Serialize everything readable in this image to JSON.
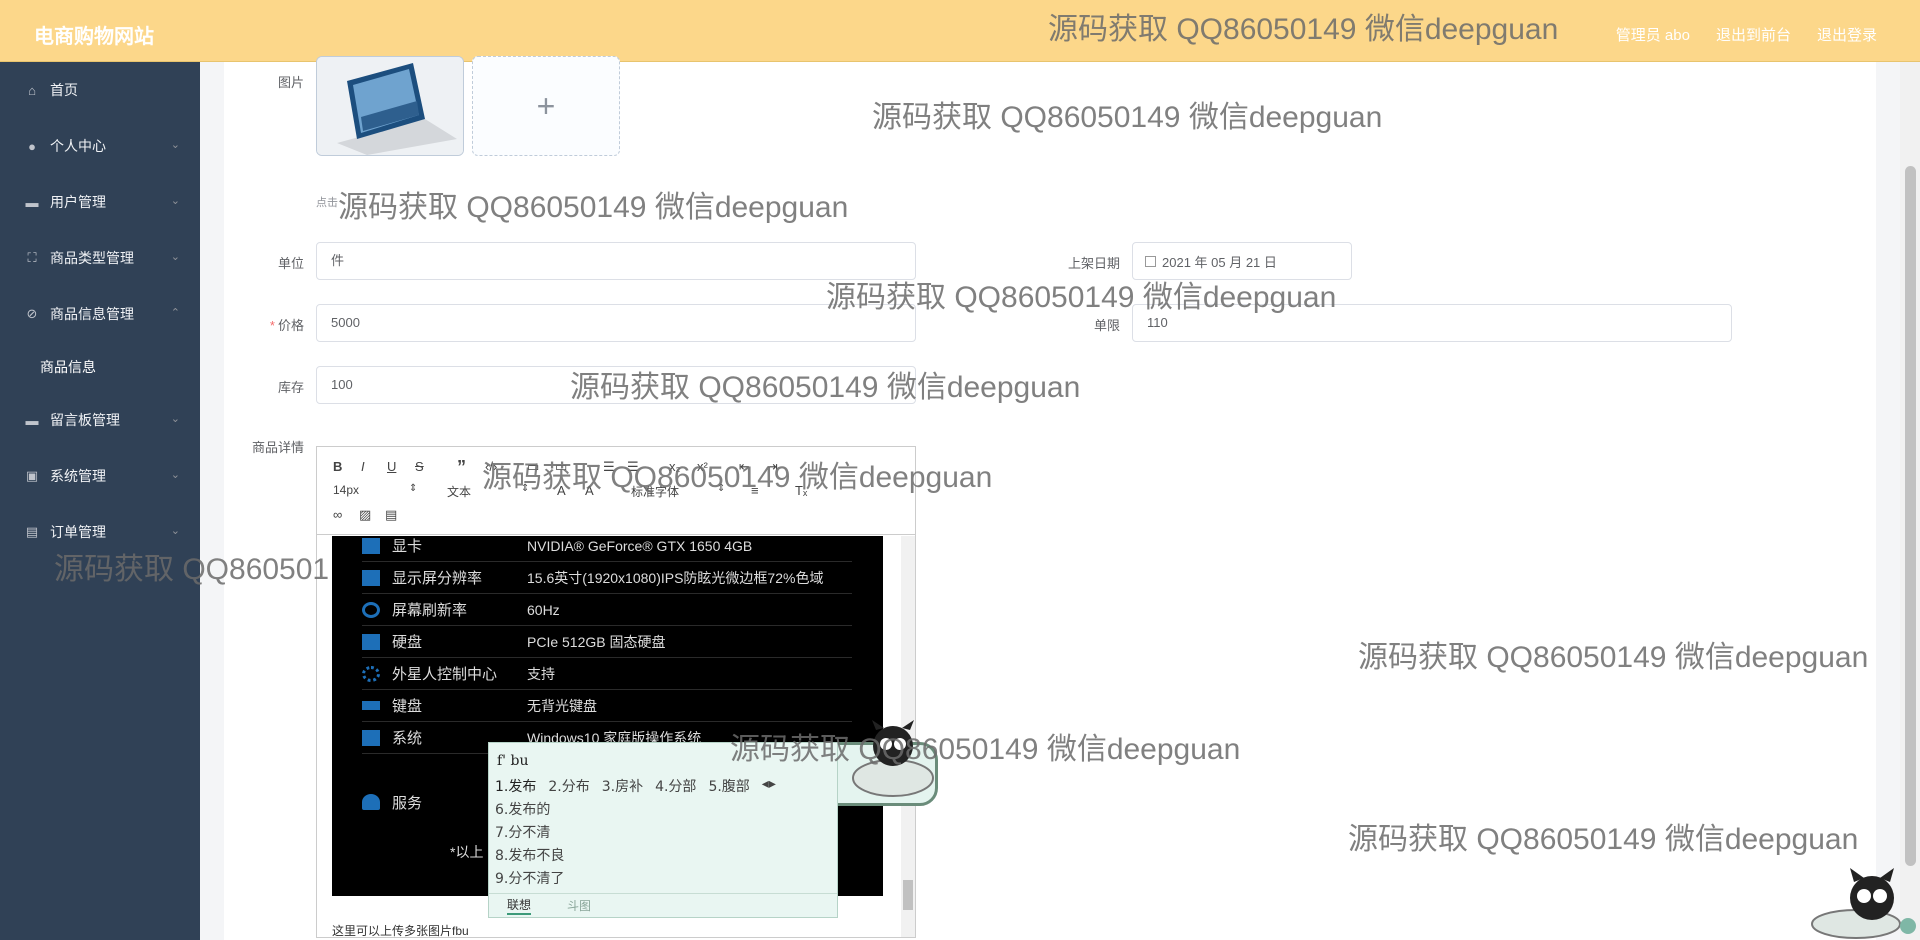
{
  "header": {
    "brand": "电商购物网站",
    "links": [
      "管理员 abo",
      "退出到前台",
      "退出登录"
    ]
  },
  "sidebar": {
    "items": [
      {
        "label": "首页",
        "icon": "home-icon",
        "arrow": ""
      },
      {
        "label": "个人中心",
        "icon": "user-icon",
        "arrow": "⌄"
      },
      {
        "label": "用户管理",
        "icon": "stamp-icon",
        "arrow": "⌄"
      },
      {
        "label": "商品类型管理",
        "icon": "fullscreen-icon",
        "arrow": "⌄"
      },
      {
        "label": "商品信息管理",
        "icon": "discount-icon",
        "arrow": "⌃"
      },
      {
        "label": "商品信息",
        "icon": "",
        "arrow": ""
      },
      {
        "label": "留言板管理",
        "icon": "chat-icon",
        "arrow": "⌄"
      },
      {
        "label": "系统管理",
        "icon": "clipboard-check-icon",
        "arrow": "⌄"
      },
      {
        "label": "订单管理",
        "icon": "document-icon",
        "arrow": "⌄"
      }
    ]
  },
  "form": {
    "image_label": "图片",
    "hint": "点击",
    "unit_label": "单位",
    "unit_value": "件",
    "price_label": "价格",
    "price_value": "5000",
    "stock_label": "库存",
    "stock_value": "100",
    "date_label": "上架日期",
    "date_value": "2021 年 05 月 21 日",
    "limit_label": "单限",
    "limit_value": "110",
    "detail_label": "商品详情"
  },
  "editor": {
    "toolbar_row1": [
      "B",
      "I",
      "U",
      "S",
      "”"
    ],
    "font_size": "14px",
    "text_format": "文本",
    "font_family": "标准字体",
    "specs": [
      {
        "name": "显卡",
        "value": "NVIDIA® GeForce® GTX 1650 4GB"
      },
      {
        "name": "显示屏分辨率",
        "value": "15.6英寸(1920x1080)IPS防眩光微边框72%色域"
      },
      {
        "name": "屏幕刷新率",
        "value": "60Hz"
      },
      {
        "name": "硬盘",
        "value": "PCIe 512GB 固态硬盘"
      },
      {
        "name": "外星人控制中心",
        "value": "支持"
      },
      {
        "name": "键盘",
        "value": "无背光键盘"
      },
      {
        "name": "系统",
        "value": "Windows10 家庭版操作系统"
      },
      {
        "name": "服务",
        "value": ""
      }
    ],
    "footnote": "*以上",
    "body_text": "这里可以上传多张图片fbu"
  },
  "ime": {
    "code": "f' bu",
    "first_row": [
      "1.发布",
      "2.分布",
      "3.房补",
      "4.分部",
      "5.腹部"
    ],
    "candidates": [
      "6.发布的",
      "7.分不清",
      "8.发布不良",
      "9.分不清了"
    ],
    "tabs": [
      "联想",
      "斗图"
    ]
  },
  "watermark": "源码获取 QQ86050149 微信deepguan",
  "watermark_partial": "源码获取 QQ860501"
}
